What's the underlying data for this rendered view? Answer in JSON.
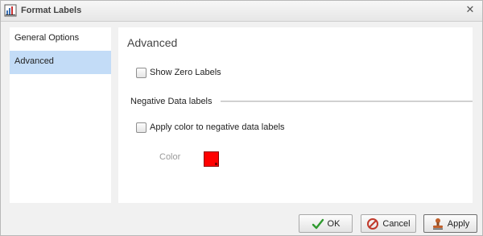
{
  "window": {
    "title": "Format Labels",
    "close_symbol": "✕",
    "icon": "format-labels-icon"
  },
  "sidebar": {
    "items": [
      {
        "label": "General Options",
        "active": false
      },
      {
        "label": "Advanced",
        "active": true
      }
    ]
  },
  "panel": {
    "title": "Advanced",
    "show_zero_labels": {
      "label": "Show Zero Labels",
      "checked": false
    },
    "negative_section": {
      "title": "Negative Data labels",
      "apply_color": {
        "label": "Apply color to negative data labels",
        "checked": false
      },
      "color_label": "Color",
      "color_value": "#ff0000"
    }
  },
  "footer": {
    "ok_label": "OK",
    "cancel_label": "Cancel",
    "apply_label": "Apply"
  },
  "icons": {
    "ok": "checkmark-icon",
    "cancel": "cancel-icon",
    "apply": "apply-stamp-icon"
  }
}
